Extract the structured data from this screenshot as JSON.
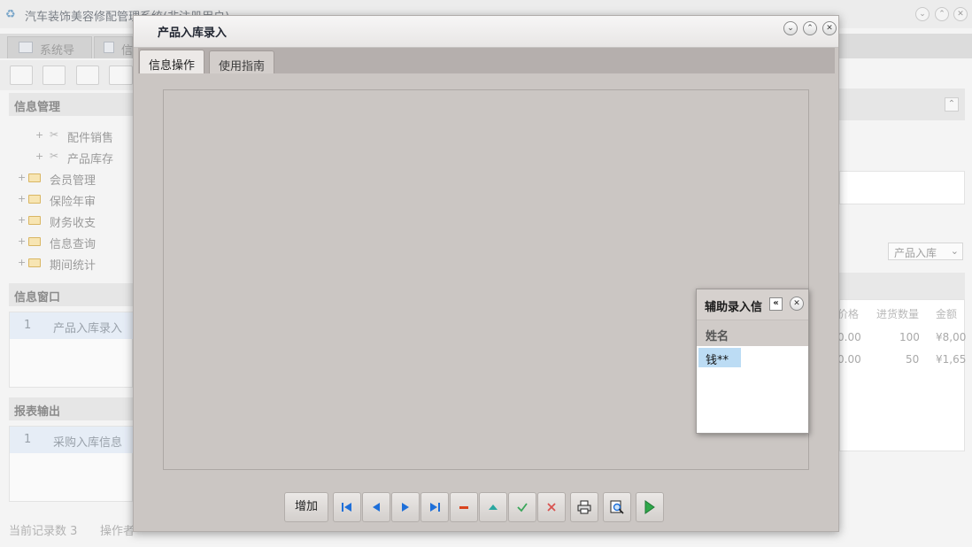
{
  "app": {
    "title": "汽车装饰美容修配管理系统(非注册用户)",
    "tabs": [
      {
        "label": "系统导航"
      },
      {
        "label": "信"
      }
    ]
  },
  "sidebar": {
    "info_mgmt": {
      "title": "信息管理",
      "items": [
        {
          "label": "配件销售",
          "type": "leaf"
        },
        {
          "label": "产品库存",
          "type": "leaf"
        },
        {
          "label": "会员管理",
          "type": "folder"
        },
        {
          "label": "保险年审",
          "type": "folder"
        },
        {
          "label": "财务收支",
          "type": "folder"
        },
        {
          "label": "信息查询",
          "type": "folder"
        },
        {
          "label": "期间统计",
          "type": "folder"
        }
      ]
    },
    "info_window": {
      "title": "信息窗口",
      "rows": [
        {
          "num": "1",
          "label": "产品入库录入"
        }
      ]
    },
    "report_output": {
      "title": "报表输出",
      "rows": [
        {
          "num": "1",
          "label": "采购入库信息"
        }
      ]
    }
  },
  "status_bar": {
    "record_count": "当前记录数 3",
    "operator": "操作者"
  },
  "background_right": {
    "select_value": "产品入库",
    "grid_headers": [
      "价格",
      "进货数量",
      "金额"
    ],
    "rows": [
      {
        "price": "0.00",
        "qty": "100",
        "amount": "¥8,00"
      },
      {
        "price": "0.00",
        "qty": "50",
        "amount": "¥1,65"
      }
    ]
  },
  "modal": {
    "title": "产品入库录入",
    "tabs": [
      {
        "label": "信息操作",
        "active": true
      },
      {
        "label": "使用指南",
        "active": false
      }
    ],
    "helper": {
      "title": "辅助录入信",
      "column": "姓名",
      "rows": [
        "钱**"
      ]
    },
    "toolbar": {
      "add_label": "增加"
    }
  },
  "colors": {
    "modal_bg": "#cbc6c3",
    "selection": "#bcdcf4",
    "nav_blue": "#1e6fd9",
    "delete_red": "#d9441e",
    "confirm_green": "#3aa65a",
    "cancel_red": "#d9534f",
    "run_green": "#2fa84a"
  }
}
